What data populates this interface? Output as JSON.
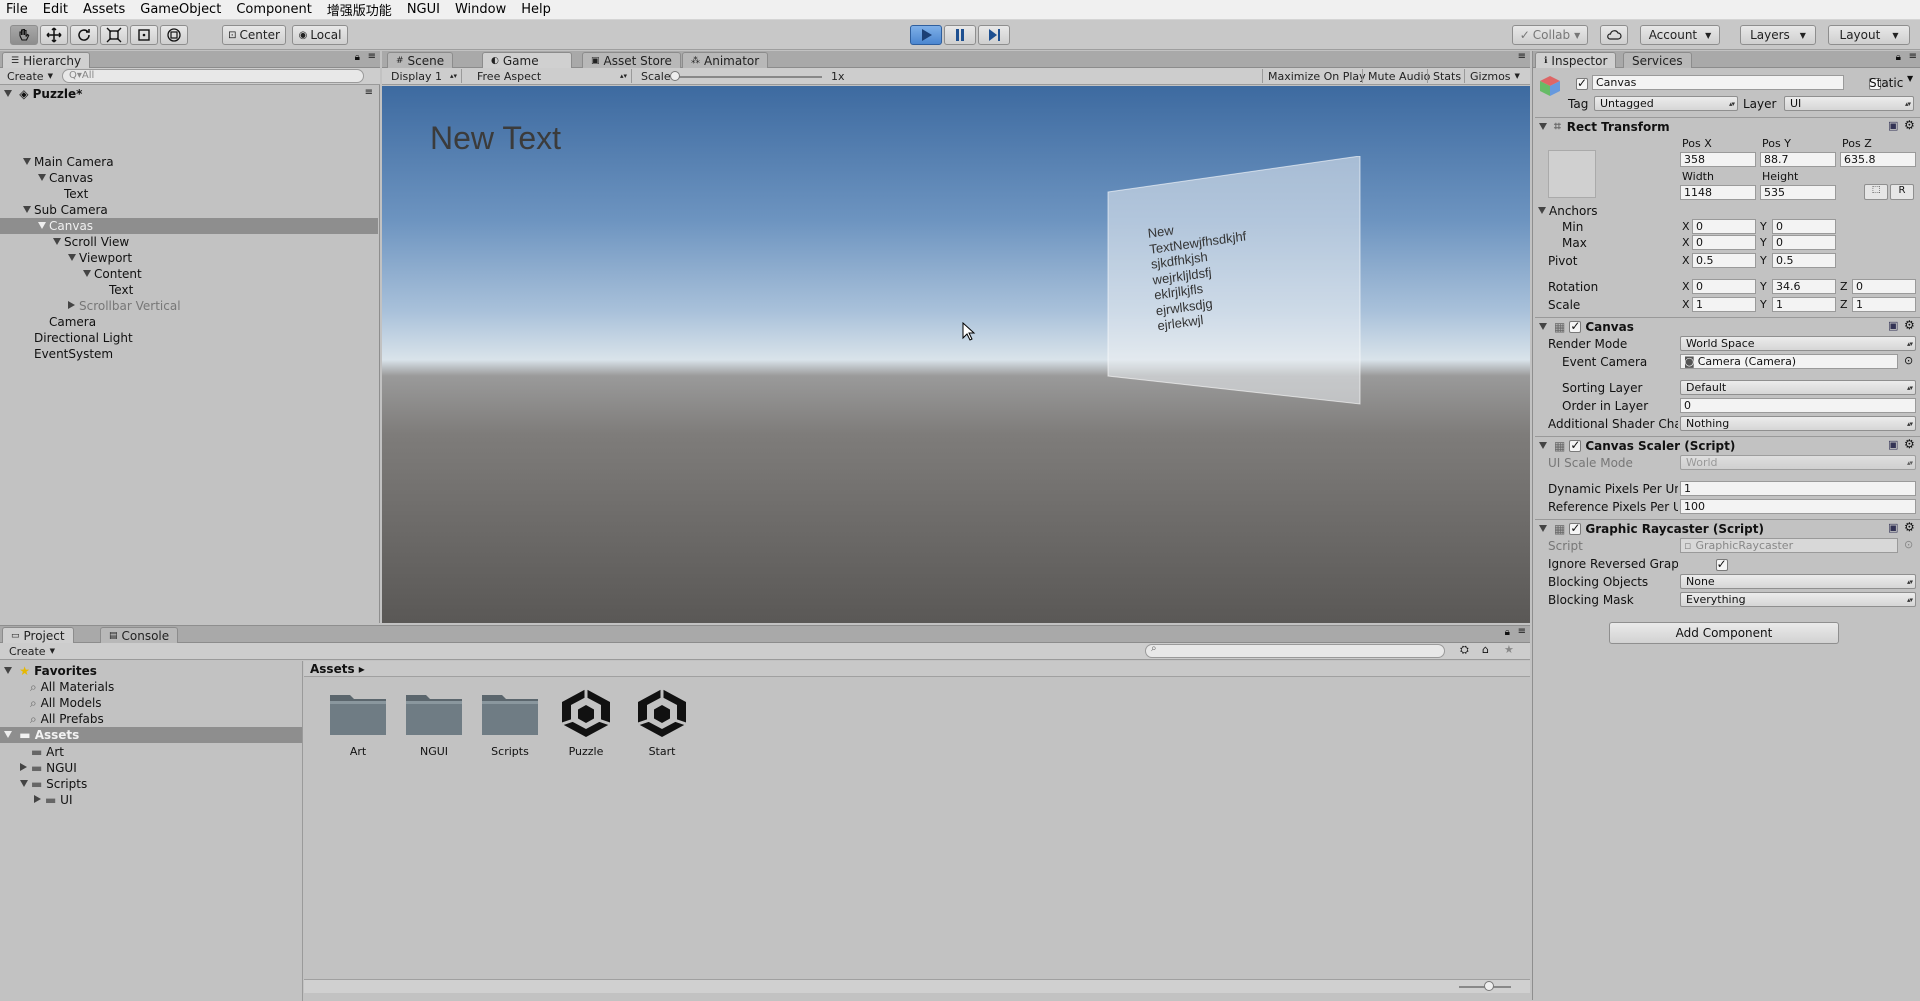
{
  "menu": [
    "File",
    "Edit",
    "Assets",
    "GameObject",
    "Component",
    "增强版功能",
    "NGUI",
    "Window",
    "Help"
  ],
  "toolbar": {
    "center": "Center",
    "local": "Local",
    "collab": "Collab",
    "account": "Account",
    "layers": "Layers",
    "layout": "Layout"
  },
  "hierarchy": {
    "tab": "Hierarchy",
    "create": "Create",
    "search_placeholder": "Q▾All",
    "scene": "Puzzle*",
    "items": [
      {
        "label": "Main Camera",
        "depth": 1,
        "toggle": "open"
      },
      {
        "label": "Canvas",
        "depth": 2,
        "toggle": "open"
      },
      {
        "label": "Text",
        "depth": 3,
        "toggle": "none"
      },
      {
        "label": "Sub Camera",
        "depth": 1,
        "toggle": "open"
      },
      {
        "label": "Canvas",
        "depth": 2,
        "toggle": "open",
        "selected": true
      },
      {
        "label": "Scroll View",
        "depth": 3,
        "toggle": "open"
      },
      {
        "label": "Viewport",
        "depth": 4,
        "toggle": "open"
      },
      {
        "label": "Content",
        "depth": 5,
        "toggle": "open"
      },
      {
        "label": "Text",
        "depth": 6,
        "toggle": "none"
      },
      {
        "label": "Scrollbar Vertical",
        "depth": 4,
        "toggle": "closed",
        "dim": true
      },
      {
        "label": "Camera",
        "depth": 2,
        "toggle": "none"
      },
      {
        "label": "Directional Light",
        "depth": 1,
        "toggle": "none"
      },
      {
        "label": "EventSystem",
        "depth": 1,
        "toggle": "none"
      }
    ]
  },
  "game": {
    "tabs": [
      "Scene",
      "Game",
      "Asset Store",
      "Animator"
    ],
    "display": "Display 1",
    "aspect": "Free Aspect",
    "scale_label": "Scale",
    "scale_value": "1x",
    "options": [
      "Maximize On Play",
      "Mute Audio",
      "Stats",
      "Gizmos"
    ],
    "overlay_text": "New Text",
    "panel_lines": [
      "New",
      "TextNewjfhsdkjhf",
      "sjkdfhkjsh",
      "wejrkljldsfj",
      "eklrjlkjfls",
      "ejrwlksdjg",
      "ejrlekwjl"
    ]
  },
  "project": {
    "tabs": [
      "Project",
      "Console"
    ],
    "create": "Create",
    "favorites": "Favorites",
    "favorite_items": [
      "All Materials",
      "All Models",
      "All Prefabs"
    ],
    "assets_root": "Assets",
    "asset_tree": [
      {
        "label": "Art",
        "depth": 1,
        "toggle": "none"
      },
      {
        "label": "NGUI",
        "depth": 1,
        "toggle": "closed"
      },
      {
        "label": "Scripts",
        "depth": 1,
        "toggle": "open"
      },
      {
        "label": "UI",
        "depth": 2,
        "toggle": "closed"
      }
    ],
    "breadcrumb": "Assets ▸",
    "grid": [
      {
        "label": "Art",
        "kind": "folder"
      },
      {
        "label": "NGUI",
        "kind": "folder"
      },
      {
        "label": "Scripts",
        "kind": "folder"
      },
      {
        "label": "Puzzle",
        "kind": "unity"
      },
      {
        "label": "Start",
        "kind": "unity"
      }
    ]
  },
  "inspector": {
    "tabs": [
      "Inspector",
      "Services"
    ],
    "object_name": "Canvas",
    "static_label": "Static",
    "tag_label": "Tag",
    "tag_value": "Untagged",
    "layer_label": "Layer",
    "layer_value": "UI",
    "rect_transform": {
      "title": "Rect Transform",
      "pos_x_label": "Pos X",
      "pos_y_label": "Pos Y",
      "pos_z_label": "Pos Z",
      "pos_x": "358",
      "pos_y": "88.7",
      "pos_z": "635.8",
      "width_label": "Width",
      "height_label": "Height",
      "width": "1148",
      "height": "535",
      "r_button": "R",
      "anchors": "Anchors",
      "min": "Min",
      "max": "Max",
      "min_x": "0",
      "min_y": "0",
      "max_x": "0",
      "max_y": "0",
      "pivot": "Pivot",
      "pivot_x": "0.5",
      "pivot_y": "0.5",
      "rotation": "Rotation",
      "rot_x": "0",
      "rot_y": "34.6",
      "rot_z": "0",
      "scale": "Scale",
      "scale_x": "1",
      "scale_y": "1",
      "scale_z": "1",
      "x": "X",
      "y": "Y",
      "z": "Z"
    },
    "canvas": {
      "title": "Canvas",
      "render_mode_label": "Render Mode",
      "render_mode": "World Space",
      "event_camera_label": "Event Camera",
      "event_camera": "Camera (Camera)",
      "sorting_layer_label": "Sorting Layer",
      "sorting_layer": "Default",
      "order_label": "Order in Layer",
      "order": "0",
      "shader_label": "Additional Shader Char",
      "shader": "Nothing"
    },
    "scaler": {
      "title": "Canvas Scaler (Script)",
      "ui_scale_label": "UI Scale Mode",
      "ui_scale": "World",
      "dynamic_label": "Dynamic Pixels Per Uni",
      "dynamic": "1",
      "reference_label": "Reference Pixels Per Ui",
      "reference": "100"
    },
    "raycaster": {
      "title": "Graphic Raycaster (Script)",
      "script_label": "Script",
      "script": "GraphicRaycaster",
      "ignore_label": "Ignore Reversed Graph",
      "blocking_objects_label": "Blocking Objects",
      "blocking_objects": "None",
      "blocking_mask_label": "Blocking Mask",
      "blocking_mask": "Everything"
    },
    "add_component": "Add Component"
  }
}
